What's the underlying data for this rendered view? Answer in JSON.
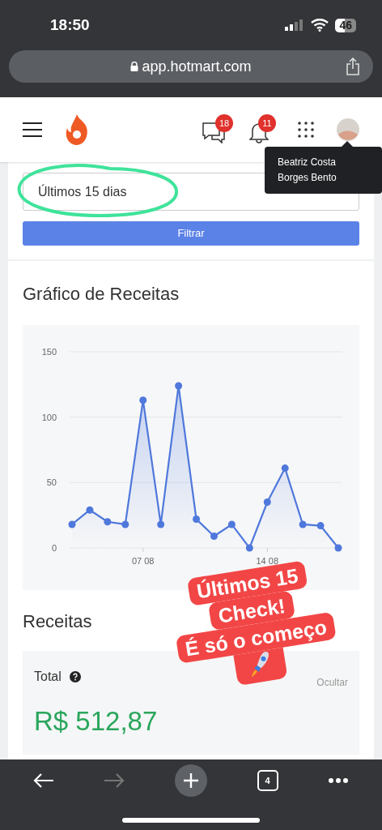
{
  "status_bar": {
    "time": "18:50",
    "battery": "46"
  },
  "browser": {
    "url": "app.hotmart.com",
    "tab_count": "4"
  },
  "header": {
    "messages_badge": "18",
    "notifications_badge": "11",
    "user_tooltip": "Beatriz Costa Borges Bento"
  },
  "filter": {
    "period": "Últimos 15 dias",
    "button": "Filtrar"
  },
  "revenue_chart": {
    "title": "Gráfico de Receitas",
    "chart_data": {
      "type": "area",
      "categories": [
        null,
        null,
        null,
        null,
        "07 08",
        null,
        null,
        null,
        null,
        null,
        null,
        "14 08",
        null,
        null,
        null,
        null
      ],
      "yticks": [
        {
          "value": 0,
          "label": "0"
        },
        {
          "value": 50,
          "label": "50"
        },
        {
          "value": 100,
          "label": "100"
        },
        {
          "value": 150,
          "label": "150"
        }
      ],
      "ylim": [
        0,
        150
      ],
      "series": [
        {
          "color": "#4f78dc",
          "values": [
            18,
            29,
            20,
            18,
            113,
            18,
            124,
            22,
            9,
            18,
            0,
            35,
            61,
            18,
            17,
            0
          ]
        }
      ]
    }
  },
  "revenue": {
    "title": "Receitas",
    "total_label": "Total",
    "hide_link": "Ocultar",
    "total_value": "R$ 512,87"
  },
  "sticker": {
    "lines": [
      "Últimos 15",
      "Check!",
      "É só o começo"
    ]
  }
}
